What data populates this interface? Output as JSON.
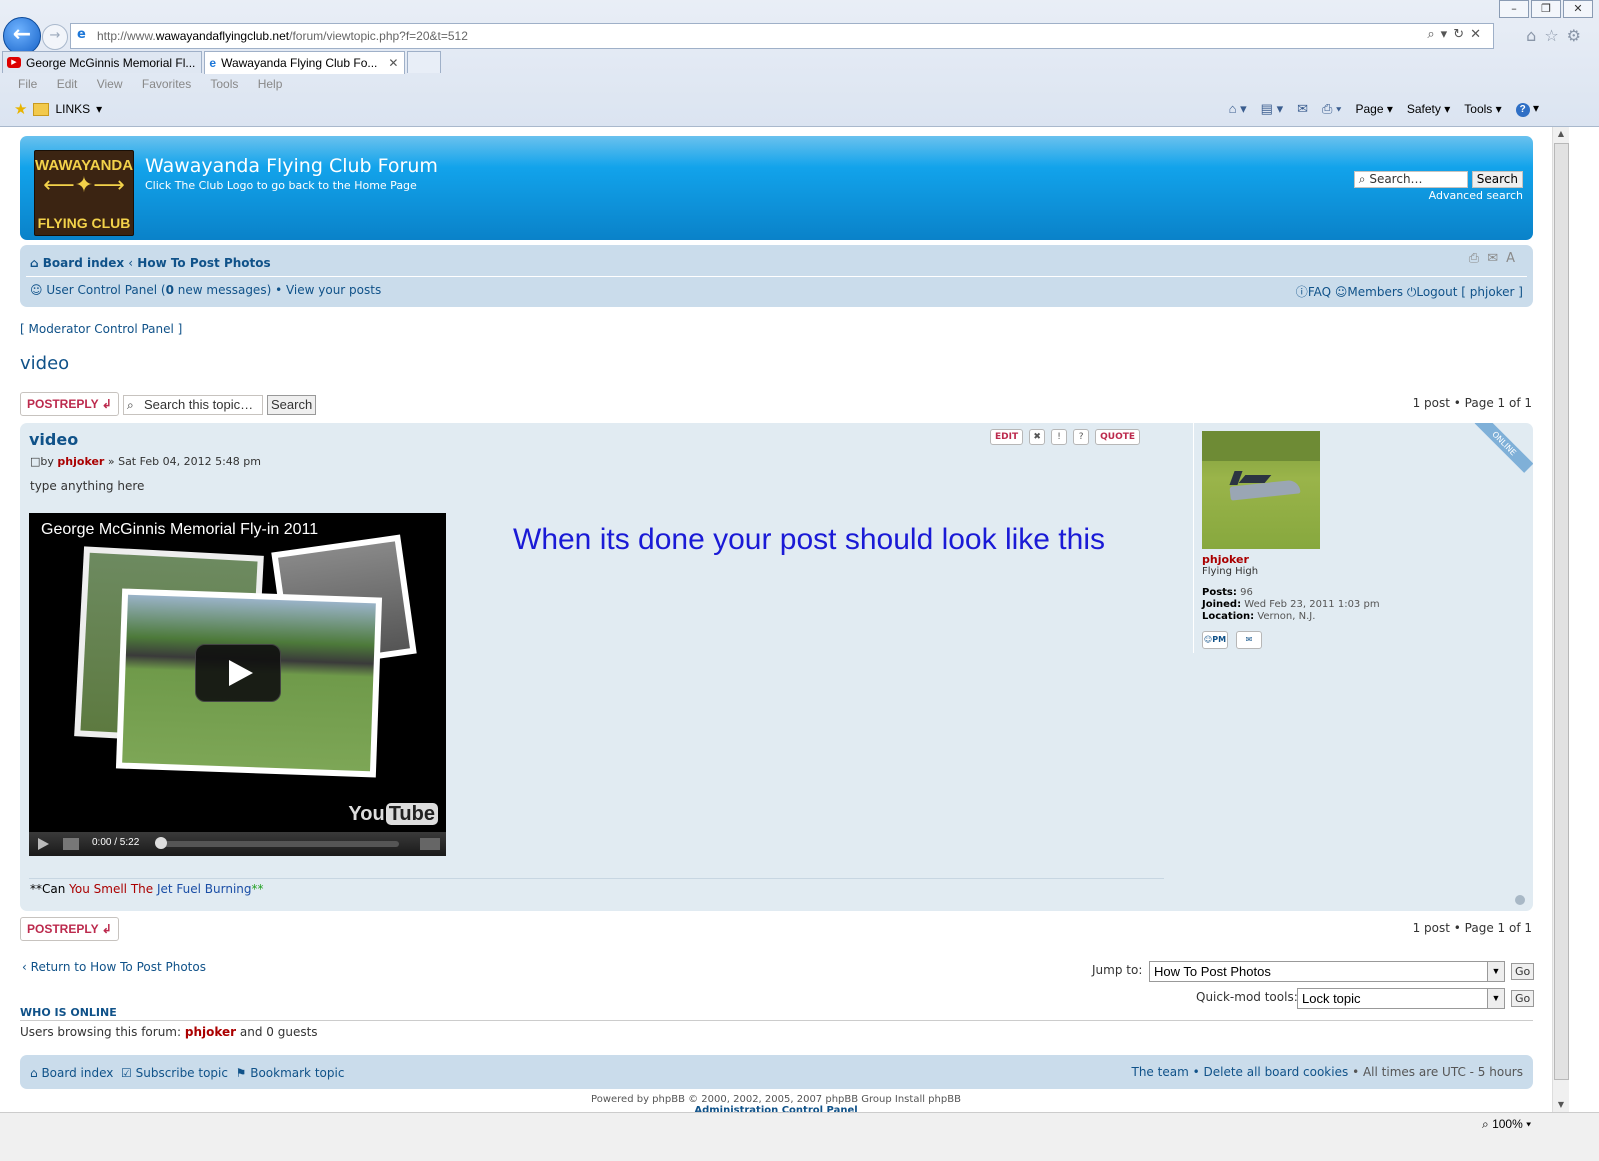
{
  "browser": {
    "url_prefix": "http://www.",
    "url_domain": "wawayandaflyingclub.net",
    "url_path": "/forum/viewtopic.php?f=20&t=512",
    "tabs": [
      {
        "label": "George McGinnis Memorial Fl..."
      },
      {
        "label": "Wawayanda Flying Club Fo..."
      }
    ],
    "menu": [
      "File",
      "Edit",
      "View",
      "Favorites",
      "Tools",
      "Help"
    ],
    "favorites_folder": "LINKS",
    "command_bar": {
      "page": "Page",
      "safety": "Safety",
      "tools": "Tools"
    },
    "zoom": "100%"
  },
  "header": {
    "logo_top": "WAWAYANDA",
    "logo_bottom": "FLYING CLUB",
    "title": "Wawayanda Flying Club Forum",
    "description": "Click The Club Logo to go back to the Home Page",
    "search_placeholder": "Search…",
    "search_button": "Search",
    "advanced_search": "Advanced search"
  },
  "navbar": {
    "board_index": "Board index",
    "crumb": "How To Post Photos",
    "ucp": "User Control Panel",
    "new_messages_count": "0",
    "new_messages_text": "new messages)",
    "view_posts": "View your posts",
    "faq": "FAQ",
    "members": "Members",
    "logout": "Logout [ phjoker ]"
  },
  "moderator_cp": "[ Moderator Control Panel ]",
  "topic": {
    "title": "video",
    "postreply": "POSTREPLY",
    "search_placeholder": "Search this topic…",
    "search_button": "Search",
    "pagination": "1 post • Page 1 of 1"
  },
  "post": {
    "subject": "video",
    "by": "by",
    "author": "phjoker",
    "date": "» Sat Feb 04, 2012 5:48 pm",
    "body": "type anything here",
    "edit": "EDIT",
    "quote": "QUOTE",
    "online": "ONLINE",
    "video_title": "George McGinnis Memorial Fly-in 2011",
    "video_time": "0:00 / 5:22",
    "video_progress": 0,
    "youtube": "You",
    "youtube_tube": "Tube",
    "note": "When its done your post should look like this",
    "signature": {
      "p1": "**Can ",
      "p2": "You Smell The ",
      "p3": "Jet Fuel Burning",
      "p4": "**"
    }
  },
  "profile": {
    "username": "phjoker",
    "rank": "Flying High",
    "posts_label": "Posts:",
    "posts": "96",
    "joined_label": "Joined:",
    "joined": "Wed Feb 23, 2011 1:03 pm",
    "location_label": "Location:",
    "location": "Vernon, N.J.",
    "pm": "PM"
  },
  "footer": {
    "return": "Return to How To Post Photos",
    "jump_to": "Jump to:",
    "jump_value": "How To Post Photos",
    "go": "Go",
    "quickmod": "Quick-mod tools:",
    "quickmod_value": "Lock topic",
    "who_online_title": "WHO IS ONLINE",
    "who_online_pre": "Users browsing this forum: ",
    "who_online_user": "phjoker",
    "who_online_post": " and 0 guests",
    "board_index": "Board index",
    "subscribe": "Subscribe topic",
    "bookmark": "Bookmark topic",
    "team": "The team",
    "delete_cookies": "Delete all board cookies",
    "times": "All times are UTC - 5 hours",
    "powered": "Powered by phpBB © 2000, 2002, 2005, 2007 phpBB Group Install phpBB",
    "acp": "Administration Control Panel"
  }
}
